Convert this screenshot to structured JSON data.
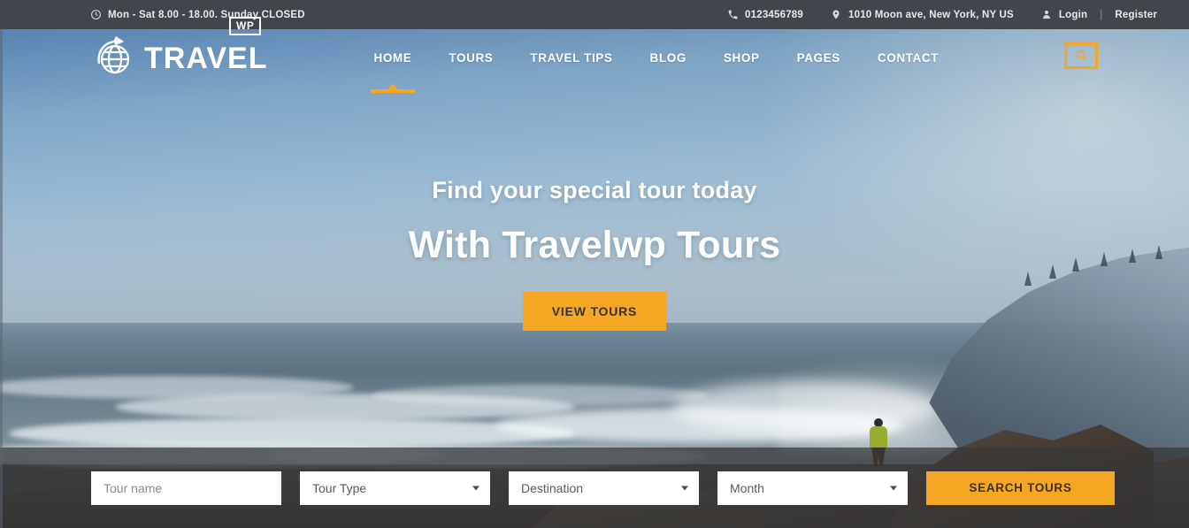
{
  "topbar": {
    "hours": "Mon - Sat 8.00 - 18.00. Sunday CLOSED",
    "hours_icon": "clock-icon",
    "phone": "0123456789",
    "phone_icon": "phone-icon",
    "address": "1010 Moon ave, New York, NY US",
    "address_icon": "location-pin-icon",
    "login": "Login",
    "login_icon": "user-icon",
    "separator": "|",
    "register": "Register"
  },
  "brand": {
    "name": "TRAVEL",
    "badge": "WP",
    "logo_icon": "globe-airplane-icon"
  },
  "nav": {
    "items": [
      {
        "label": "HOME",
        "active": true
      },
      {
        "label": "TOURS",
        "active": false
      },
      {
        "label": "TRAVEL TIPS",
        "active": false
      },
      {
        "label": "BLOG",
        "active": false
      },
      {
        "label": "SHOP",
        "active": false
      },
      {
        "label": "PAGES",
        "active": false
      },
      {
        "label": "CONTACT",
        "active": false
      }
    ],
    "search_icon": "search-icon"
  },
  "hero": {
    "subtitle": "Find your special tour today",
    "title": "With Travelwp Tours",
    "cta": "VIEW TOURS"
  },
  "search_form": {
    "tour_name_placeholder": "Tour name",
    "tour_type_value": "Tour Type",
    "destination_value": "Destination",
    "month_value": "Month",
    "submit_label": "SEARCH TOURS"
  },
  "colors": {
    "accent": "#f5a623",
    "topbar_bg": "#41464d",
    "searchbar_bg": "rgba(56,56,56,.72)",
    "text_light": "#ffffff"
  }
}
